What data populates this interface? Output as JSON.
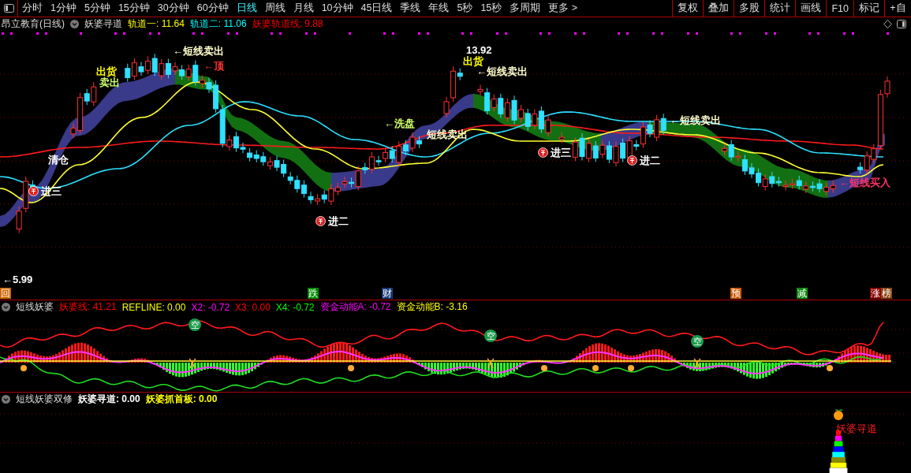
{
  "toolbar": {
    "periods": [
      {
        "label": "分时",
        "selected": false
      },
      {
        "label": "1分钟",
        "selected": false
      },
      {
        "label": "5分钟",
        "selected": false
      },
      {
        "label": "15分钟",
        "selected": false
      },
      {
        "label": "30分钟",
        "selected": false
      },
      {
        "label": "60分钟",
        "selected": false
      },
      {
        "label": "日线",
        "selected": true
      },
      {
        "label": "周线",
        "selected": false
      },
      {
        "label": "月线",
        "selected": false
      },
      {
        "label": "10分钟",
        "selected": false
      },
      {
        "label": "45日线",
        "selected": false
      },
      {
        "label": "季线",
        "selected": false
      },
      {
        "label": "年线",
        "selected": false
      },
      {
        "label": "5秒",
        "selected": false
      },
      {
        "label": "15秒",
        "selected": false
      },
      {
        "label": "多周期",
        "selected": false
      },
      {
        "label": "更多 >",
        "selected": false
      }
    ],
    "tools": [
      "复权",
      "叠加",
      "多股",
      "统计",
      "画线",
      "F10",
      "标记",
      "+自"
    ]
  },
  "main_panel": {
    "title": "昂立教育(日线)",
    "indicator": "妖婆寻道",
    "readings": [
      {
        "text": "轨道一: 11.64",
        "color": "#ffff00"
      },
      {
        "text": "轨道二: 11.06",
        "color": "#00ffff"
      },
      {
        "text": "妖婆轨道线: 9.88",
        "color": "#ff0000"
      }
    ],
    "annotations": [
      {
        "text": "←短线卖出",
        "kind": "signal",
        "color": "#ffffcc"
      },
      {
        "text": "出货",
        "kind": "signal",
        "color": "#ffff00"
      },
      {
        "text": "卖出",
        "kind": "signal",
        "color": "#ccff66"
      },
      {
        "text": "←顶",
        "kind": "signal",
        "color": "#ff3333"
      },
      {
        "text": "清仓",
        "kind": "signal",
        "color": "#ffffff"
      },
      {
        "text": "进三",
        "kind": "entry",
        "color": "#ffffff"
      },
      {
        "text": "←5.99",
        "kind": "price",
        "color": "#ffffff"
      },
      {
        "text": "13.92",
        "kind": "price",
        "color": "#ffffff"
      },
      {
        "text": "出货",
        "kind": "signal",
        "color": "#ffff00"
      },
      {
        "text": "←短线卖出",
        "kind": "signal",
        "color": "#ffffcc"
      },
      {
        "text": "←洗盘",
        "kind": "signal",
        "color": "#ccff66"
      },
      {
        "text": "短线卖出",
        "kind": "signal",
        "color": "#ffffcc"
      },
      {
        "text": "进二",
        "kind": "entry",
        "color": "#ffffff"
      },
      {
        "text": "进三",
        "kind": "entry",
        "color": "#ffffff"
      },
      {
        "text": "进二",
        "kind": "entry",
        "color": "#ffffff"
      },
      {
        "text": "←短线卖出",
        "kind": "signal",
        "color": "#ffffcc"
      },
      {
        "text": "←短线买入",
        "kind": "signal",
        "color": "#ff3366"
      }
    ],
    "badges": [
      {
        "text": "回",
        "color": "#cc6600"
      },
      {
        "text": "跌",
        "color": "#008800"
      },
      {
        "text": "财",
        "color": "#1a3a7a"
      },
      {
        "text": "预",
        "color": "#cc5500"
      },
      {
        "text": "减",
        "color": "#118811"
      },
      {
        "text": "涨",
        "color": "#8b0000"
      },
      {
        "text": "榜",
        "color": "#8b4513"
      }
    ]
  },
  "oscillator_panel": {
    "title": "短线妖婆",
    "readings": [
      {
        "text": "妖婆线: 41.21",
        "color": "#ff0000"
      },
      {
        "text": "REFLINE: 0.00",
        "color": "#ffff00"
      },
      {
        "text": "X2: -0.72",
        "color": "#ff00ff"
      },
      {
        "text": "X3: 0.00",
        "color": "#ff0000"
      },
      {
        "text": "X4: -0.72",
        "color": "#00ff00"
      },
      {
        "text": "资金动能A: -0.72",
        "color": "#ff00ff"
      },
      {
        "text": "资金动能B: -3.16",
        "color": "#ffff00"
      }
    ],
    "markers": [
      "空",
      "空",
      "空"
    ]
  },
  "signal_panel": {
    "title": "短线妖婆双修",
    "readings": [
      {
        "text": "妖婆寻道: 0.00",
        "color": "#ffffff"
      },
      {
        "text": "妖婆抓首板: 0.00",
        "color": "#ffff00"
      }
    ],
    "tower_label": "妖婆寻道"
  }
}
